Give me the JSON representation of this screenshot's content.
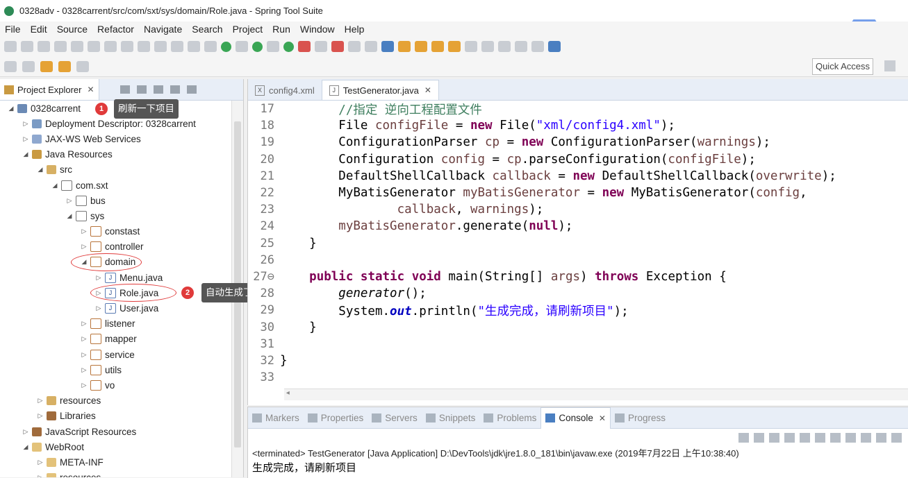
{
  "window": {
    "title": "0328adv - 0328carrent/src/com/sxt/sys/domain/Role.java - Spring Tool Suite"
  },
  "menu": [
    "File",
    "Edit",
    "Source",
    "Refactor",
    "Navigate",
    "Search",
    "Project",
    "Run",
    "Window",
    "Help"
  ],
  "quick_access": "Quick Access",
  "explorer": {
    "tab_label": "Project Explorer",
    "tree": [
      {
        "label": "0328carrent",
        "arrow": "◢",
        "icon": "proj",
        "indent": 0
      },
      {
        "label": "Deployment Descriptor: 0328carrent",
        "arrow": "▷",
        "icon": "desc",
        "indent": 1
      },
      {
        "label": "JAX-WS Web Services",
        "arrow": "▷",
        "icon": "ws",
        "indent": 1
      },
      {
        "label": "Java Resources",
        "arrow": "◢",
        "icon": "jr",
        "indent": 1
      },
      {
        "label": "src",
        "arrow": "◢",
        "icon": "src",
        "indent": 2
      },
      {
        "label": "com.sxt",
        "arrow": "◢",
        "icon": "pkg",
        "indent": 3
      },
      {
        "label": "bus",
        "arrow": "▷",
        "icon": "pkg",
        "indent": 4
      },
      {
        "label": "sys",
        "arrow": "◢",
        "icon": "pkg",
        "indent": 4
      },
      {
        "label": "constast",
        "arrow": "▷",
        "icon": "pkgo",
        "indent": 5
      },
      {
        "label": "controller",
        "arrow": "▷",
        "icon": "pkgo",
        "indent": 5
      },
      {
        "label": "domain",
        "arrow": "◢",
        "icon": "pkgo",
        "indent": 5
      },
      {
        "label": "Menu.java",
        "arrow": "▷",
        "icon": "java",
        "indent": 6
      },
      {
        "label": "Role.java",
        "arrow": "▷",
        "icon": "java",
        "indent": 6
      },
      {
        "label": "User.java",
        "arrow": "▷",
        "icon": "java",
        "indent": 6
      },
      {
        "label": "listener",
        "arrow": "▷",
        "icon": "pkgo",
        "indent": 5
      },
      {
        "label": "mapper",
        "arrow": "▷",
        "icon": "pkgo",
        "indent": 5
      },
      {
        "label": "service",
        "arrow": "▷",
        "icon": "pkgo",
        "indent": 5
      },
      {
        "label": "utils",
        "arrow": "▷",
        "icon": "pkgo",
        "indent": 5
      },
      {
        "label": "vo",
        "arrow": "▷",
        "icon": "pkgo",
        "indent": 5
      },
      {
        "label": "resources",
        "arrow": "▷",
        "icon": "src",
        "indent": 2
      },
      {
        "label": "Libraries",
        "arrow": "▷",
        "icon": "lib",
        "indent": 2
      },
      {
        "label": "JavaScript Resources",
        "arrow": "▷",
        "icon": "lib",
        "indent": 1
      },
      {
        "label": "WebRoot",
        "arrow": "◢",
        "icon": "fold",
        "indent": 1
      },
      {
        "label": "META-INF",
        "arrow": "▷",
        "icon": "fold",
        "indent": 2
      },
      {
        "label": "resources",
        "arrow": "▷",
        "icon": "fold",
        "indent": 2
      }
    ]
  },
  "annotations": {
    "badge1": "1",
    "tip1": "刷新一下项目",
    "badge2": "2",
    "tip2": "自动生成了"
  },
  "editor": {
    "tabs": [
      {
        "label": "config4.xml",
        "icon": "X",
        "active": false
      },
      {
        "label": "TestGenerator.java",
        "icon": "J",
        "active": true
      }
    ],
    "lines": [
      {
        "n": "17",
        "code": "        //指定 逆向工程配置文件"
      },
      {
        "n": "18",
        "code": "        File configFile = new File(\"xml/config4.xml\");"
      },
      {
        "n": "19",
        "code": "        ConfigurationParser cp = new ConfigurationParser(warnings);"
      },
      {
        "n": "20",
        "code": "        Configuration config = cp.parseConfiguration(configFile);"
      },
      {
        "n": "21",
        "code": "        DefaultShellCallback callback = new DefaultShellCallback(overwrite);"
      },
      {
        "n": "22",
        "code": "        MyBatisGenerator myBatisGenerator = new MyBatisGenerator(config,"
      },
      {
        "n": "23",
        "code": "                callback, warnings);"
      },
      {
        "n": "24",
        "code": "        myBatisGenerator.generate(null);"
      },
      {
        "n": "25",
        "code": "    }"
      },
      {
        "n": "26",
        "code": ""
      },
      {
        "n": "27⊖",
        "code": "    public static void main(String[] args) throws Exception {"
      },
      {
        "n": "28",
        "code": "        generator();"
      },
      {
        "n": "29",
        "code": "        System.out.println(\"生成完成，请刷新项目\");"
      },
      {
        "n": "30",
        "code": "    }"
      },
      {
        "n": "31",
        "code": ""
      },
      {
        "n": "32",
        "code": "}"
      },
      {
        "n": "33",
        "code": ""
      }
    ]
  },
  "console": {
    "tabs": [
      "Markers",
      "Properties",
      "Servers",
      "Snippets",
      "Problems",
      "Console",
      "Progress"
    ],
    "active_tab": "Console",
    "info": "<terminated> TestGenerator [Java Application] D:\\DevTools\\jdk\\jre1.8.0_181\\bin\\javaw.exe (2019年7月22日 上午10:38:40)",
    "output": "生成完成，请刷新项目"
  }
}
